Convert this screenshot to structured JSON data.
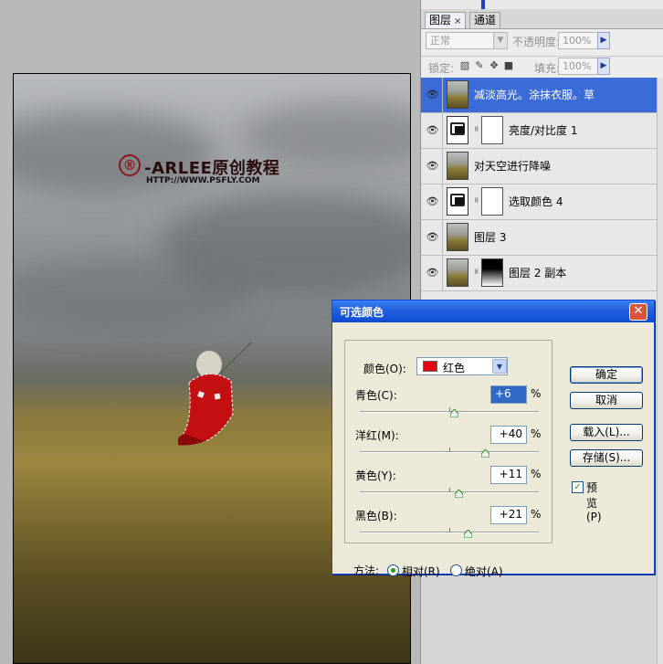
{
  "canvas": {
    "watermark_logo": "®",
    "watermark_title": "-ARLEE原创教程",
    "watermark_url": "HTTP://WWW.PSFLY.COM"
  },
  "layers_panel": {
    "tabs": [
      {
        "label": "图层",
        "active": true
      },
      {
        "label": "通道",
        "active": false
      }
    ],
    "tab_close": "×",
    "blend_mode": "正常",
    "opacity_label": "不透明度:",
    "opacity_value": "100%",
    "lock_label": "锁定:",
    "fill_label": "填充:",
    "fill_value": "100%",
    "layers": [
      {
        "name": "减淡高光。涂抹衣服。草",
        "visible": true,
        "selected": true,
        "thumb": "photo",
        "mask": false
      },
      {
        "name": "亮度/对比度 1",
        "visible": true,
        "selected": false,
        "thumb": "adjustment",
        "mask": true
      },
      {
        "name": "对天空进行降噪",
        "visible": true,
        "selected": false,
        "thumb": "photo",
        "mask": false
      },
      {
        "name": "选取颜色 4",
        "visible": true,
        "selected": false,
        "thumb": "adjustment",
        "mask": true
      },
      {
        "name": "图层 3",
        "visible": true,
        "selected": false,
        "thumb": "photo",
        "mask": false
      },
      {
        "name": "图层 2 副本",
        "visible": true,
        "selected": false,
        "thumb": "photo",
        "mask": true
      }
    ]
  },
  "dialog": {
    "title": "可选颜色",
    "close": "✕",
    "colors_label": "颜色(O):",
    "colors_value": "红色",
    "colors_swatch": "#e30613",
    "sliders": [
      {
        "label": "青色(C):",
        "value": "+6",
        "percent": 6
      },
      {
        "label": "洋红(M):",
        "value": "+40",
        "percent": 40
      },
      {
        "label": "黄色(Y):",
        "value": "+11",
        "percent": 11
      },
      {
        "label": "黑色(B):",
        "value": "+21",
        "percent": 21
      }
    ],
    "pct": "%",
    "buttons": {
      "ok": "确定",
      "cancel": "取消",
      "load": "载入(L)...",
      "save": "存储(S)..."
    },
    "preview_label": "预览(P)",
    "preview_checked": true,
    "method_label": "方法:",
    "method_relative": "相对(R)",
    "method_absolute": "绝对(A)",
    "method_selected": "relative"
  }
}
